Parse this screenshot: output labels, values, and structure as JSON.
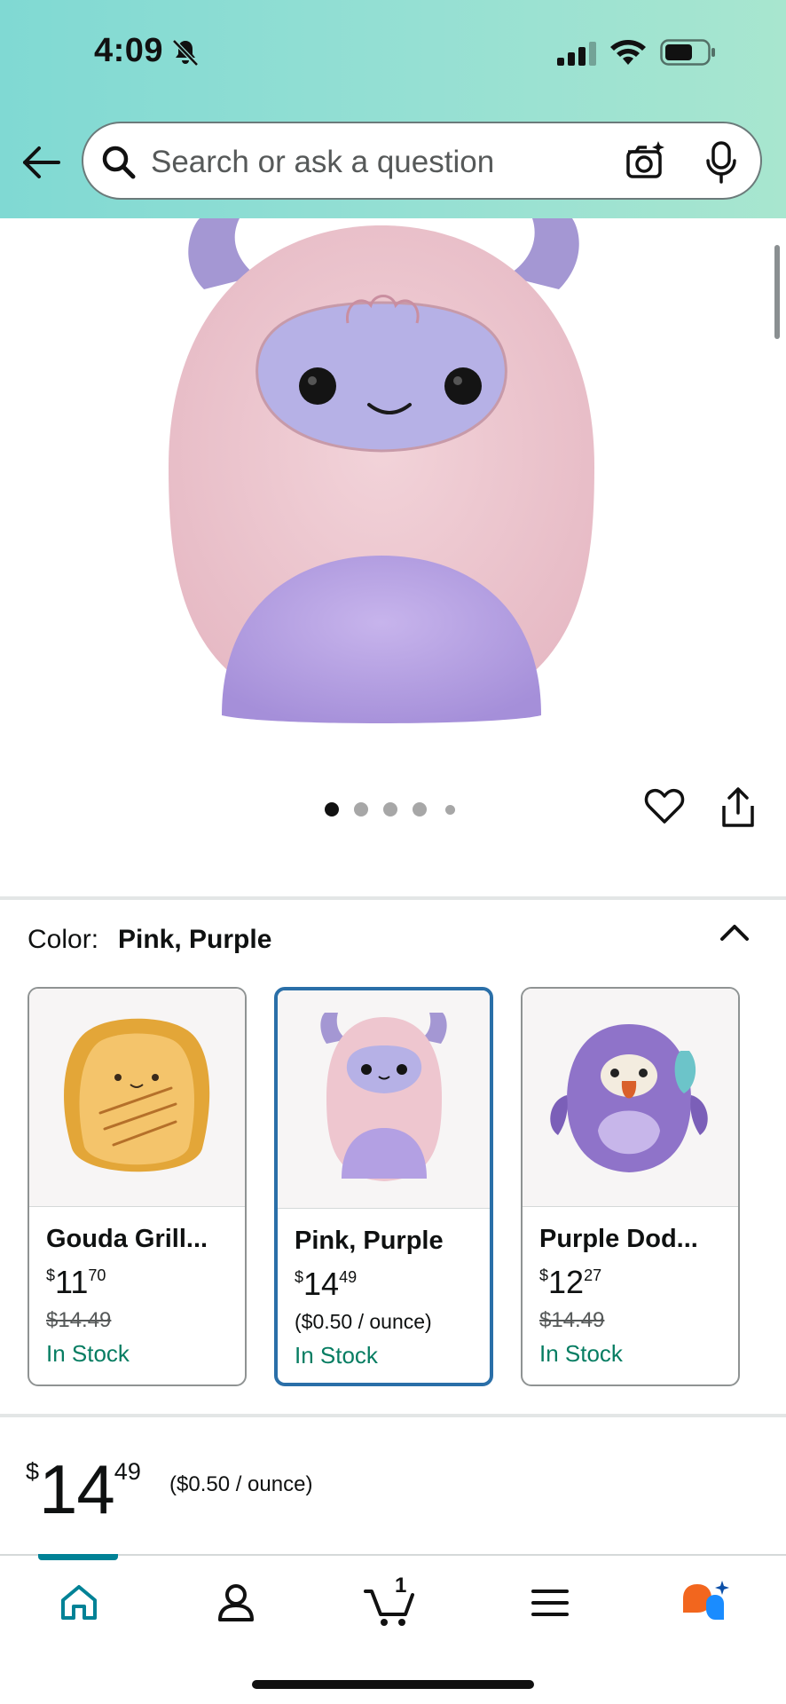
{
  "status_bar": {
    "time": "4:09"
  },
  "search": {
    "placeholder": "Search or ask a question"
  },
  "carousel": {
    "total": 5,
    "active_index": 0
  },
  "color_section": {
    "label": "Color:",
    "selected": "Pink, Purple",
    "variants": [
      {
        "name": "Gouda Grill...",
        "price_symbol": "$",
        "price_whole": "11",
        "price_fraction": "70",
        "list_price": "$14.49",
        "unit_price": "",
        "stock": "In Stock",
        "selected": false
      },
      {
        "name": "Pink, Purple",
        "price_symbol": "$",
        "price_whole": "14",
        "price_fraction": "49",
        "list_price": "",
        "unit_price": "($0.50 / ounce)",
        "stock": "In Stock",
        "selected": true
      },
      {
        "name": "Purple Dod...",
        "price_symbol": "$",
        "price_whole": "12",
        "price_fraction": "27",
        "list_price": "$14.49",
        "unit_price": "",
        "stock": "In Stock",
        "selected": false
      }
    ]
  },
  "price": {
    "symbol": "$",
    "whole": "14",
    "fraction": "49",
    "unit": "($0.50 / ounce)"
  },
  "bottom_nav": {
    "active": "home",
    "cart_count": "1"
  },
  "colors": {
    "header_gradient_start": "#80d9d3",
    "header_gradient_end": "#a8e6cf",
    "selected_border": "#2a6fa8",
    "in_stock": "#067d62",
    "nav_active": "#008296"
  }
}
